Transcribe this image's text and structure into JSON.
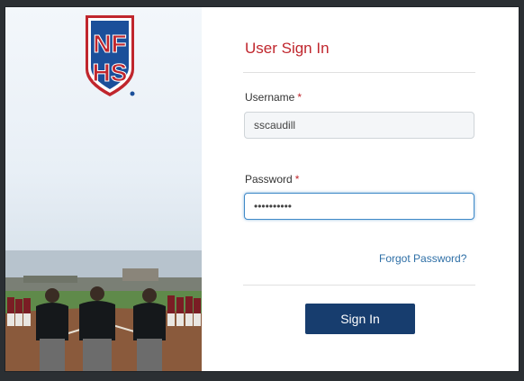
{
  "brand": {
    "logo_letters_top": "NF",
    "logo_letters_bottom": "HS",
    "colors": {
      "red": "#c0262d",
      "blue": "#1b4f9a",
      "navy": "#173d6e"
    }
  },
  "signin": {
    "title": "User Sign In",
    "username_label": "Username",
    "username_value": "sscaudill",
    "password_label": "Password",
    "password_value": "••••••••••",
    "required_mark": "*",
    "forgot_link": "Forgot Password?",
    "submit_label": "Sign In"
  }
}
